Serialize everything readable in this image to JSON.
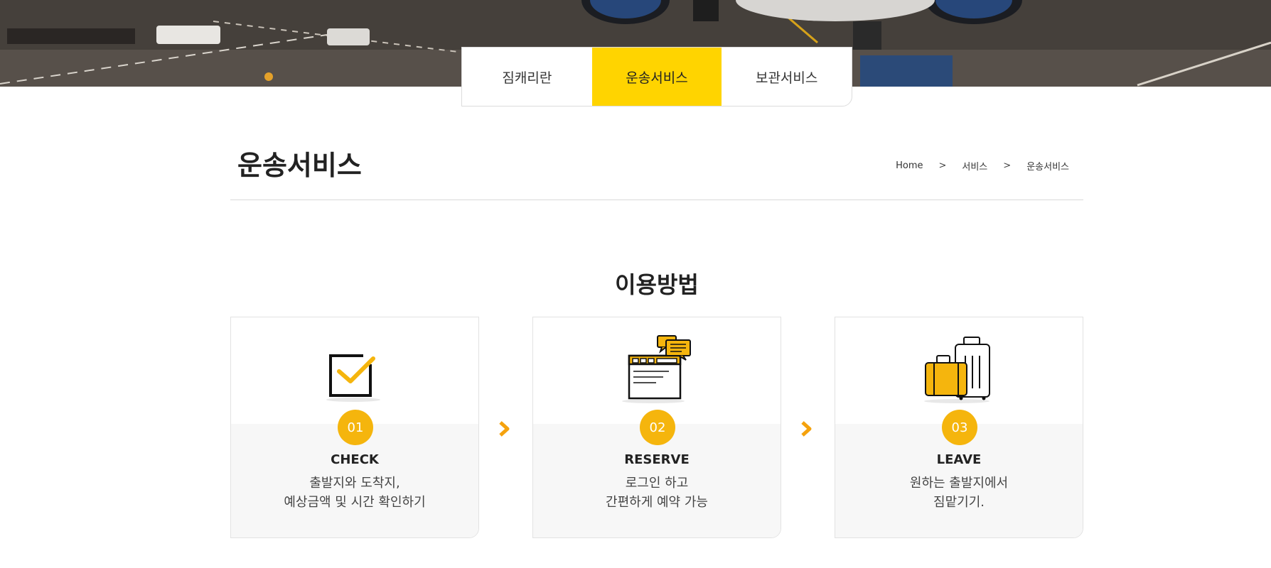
{
  "tabs": [
    {
      "label": "짐캐리란",
      "active": false
    },
    {
      "label": "운송서비스",
      "active": true
    },
    {
      "label": "보관서비스",
      "active": false
    }
  ],
  "page": {
    "title": "운송서비스",
    "breadcrumb": [
      "Home",
      "서비스",
      "운송서비스"
    ],
    "breadcrumb_separator": ">"
  },
  "section": {
    "title": "이용방법"
  },
  "steps": [
    {
      "num": "01",
      "title": "CHECK",
      "desc1": "출발지와 도착지,",
      "desc2": "예상금액 및 시간 확인하기",
      "icon": "checkbox-icon"
    },
    {
      "num": "02",
      "title": "RESERVE",
      "desc1": "로그인 하고",
      "desc2": "간편하게 예약 가능",
      "icon": "reservation-screen-icon"
    },
    {
      "num": "03",
      "title": "LEAVE",
      "desc1": "원하는 출발지에서",
      "desc2": "짐맡기기.",
      "icon": "luggage-icon"
    }
  ],
  "colors": {
    "accent": "#ffd400",
    "step_circle": "#f5b50d",
    "arrow": "#f5a20d"
  }
}
